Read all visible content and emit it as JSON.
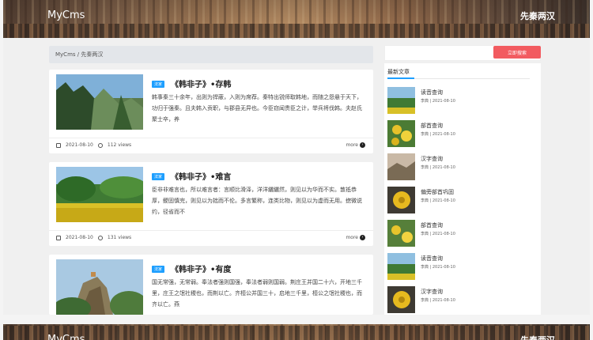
{
  "header": {
    "brand": "MyCms",
    "nav_right": "先秦两汉"
  },
  "breadcrumb": "MyCms / 先秦两汉",
  "search": {
    "button_label": "立即搜索",
    "placeholder": ""
  },
  "articles": [
    {
      "tag": "法家",
      "title": "《韩非子》•存韩",
      "excerpt": "韩事秦三十余年，出则为捍蔽，入则为席荐。秦特出锐师取韩地，而随之怨悬于天下，功归于强秦。且夫韩入贡职，与郡县无异也。今臣窃闻贵臣之计，举兵将伐韩。夫赵氏聚士卒，养",
      "date": "2021-08-10",
      "views": "112 views",
      "more": "more"
    },
    {
      "tag": "法家",
      "title": "《韩非子》•难言",
      "excerpt": "臣非非难言也，所以难言者：言顺比滑泽，洋洋纚纚然，则见以为华而不实。敦祗恭厚，鲠固慎完，则见以为拙而不伦。多言繁称，连类比物，则见以为虚而无用。揔微说约，径省而不",
      "date": "2021-08-10",
      "views": "131 views",
      "more": "more"
    },
    {
      "tag": "法家",
      "title": "《韩非子》•有度",
      "excerpt": "国无常强，无常弱。奉法者强则国强，奉法者弱则国弱。荆庄王并国二十六，开地三千里，庄王之氓社稷也，而荆以亡。齐桓公并国三十，启地三千里，桓公之氓社稷也，而齐以亡。燕",
      "date": "",
      "views": "",
      "more": ""
    }
  ],
  "sidebar": {
    "title": "最新文章",
    "items": [
      {
        "name": "读音查询",
        "meta": "李典 | 2021-08-10"
      },
      {
        "name": "部首查询",
        "meta": "李典 | 2021-08-10"
      },
      {
        "name": "汉字查询",
        "meta": "李典 | 2021-08-10"
      },
      {
        "name": "偏旁部首巩固",
        "meta": "李典 | 2021-08-10"
      },
      {
        "name": "部首查询",
        "meta": "李典 | 2021-08-10"
      },
      {
        "name": "读音查询",
        "meta": "李典 | 2021-08-10"
      },
      {
        "name": "汉字查询",
        "meta": "李典 | 2021-08-10"
      }
    ]
  },
  "colors": {
    "accent": "#1e9fff",
    "search_button": "#f25b60",
    "text": "#333333"
  },
  "icons": {
    "date": "calendar-icon",
    "views": "fire-icon",
    "more": "arrow-right-circle-icon"
  }
}
